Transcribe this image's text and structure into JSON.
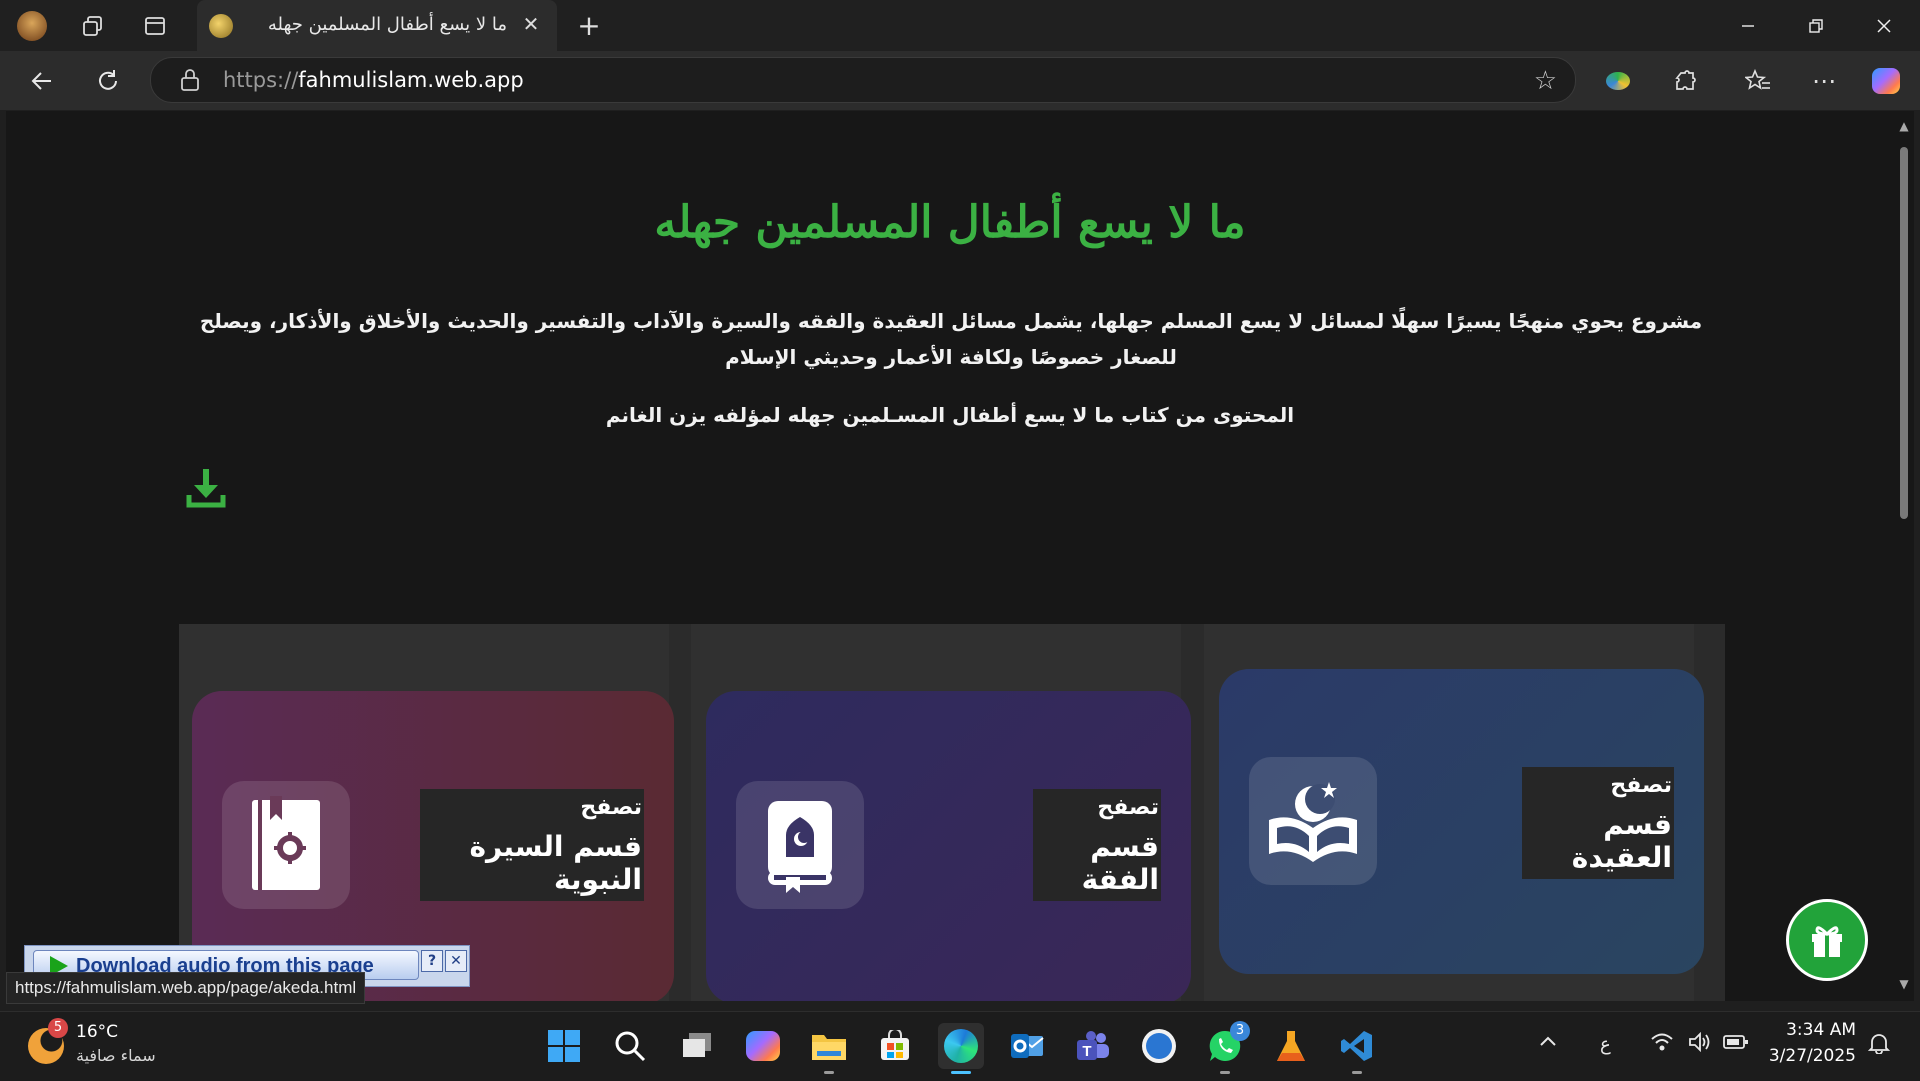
{
  "browser": {
    "tab_title": "ما لا يسع أطفال المسلمين جهله",
    "tab_close": "✕",
    "new_tab": "+",
    "url_prefix": "https://",
    "url_domain": "fahmulislam.web.app",
    "status_url": "https://fahmulislam.web.app/page/akeda.html"
  },
  "page": {
    "title": "ما لا يسع أطفال المسلمين جهله",
    "description": "مشروع يحوي منهجًا يسيرًا سهلًا لمسائل لا يسع المسلم جهلها، يشمل مسائل العقيدة والفقه والسيرة والآداب والتفسير والحديث والأخلاق والأذكار، ويصلح للصغار خصوصًا ولكافة الأعمار وحديثي الإسلام",
    "source": "المحتوى من كتاب ما لا يسع أطفال المسـلمين جهله لمؤلفه يزن الغانم",
    "accent_color": "#3bb143",
    "cards": [
      {
        "small": "تصفح",
        "big": "قسم العقيدة",
        "icon": "quran-crescent-icon",
        "color": "#2b3d5e"
      },
      {
        "small": "تصفح",
        "big": "قسم الفقة",
        "icon": "book-mosque-icon",
        "color": "#33295a"
      },
      {
        "small": "تصفح",
        "big": "قسم السيرة النبوية",
        "icon": "seerah-book-icon",
        "color": "#5a2b45"
      }
    ]
  },
  "extension": {
    "download_audio": "Download audio from this page",
    "help": "?",
    "close": "✕"
  },
  "taskbar": {
    "weather_badge": "5",
    "temperature": "16°C",
    "condition": "سماء صافية",
    "whatsapp_badge": "3",
    "language": "ع",
    "time": "3:34 AM",
    "date": "3/27/2025"
  }
}
